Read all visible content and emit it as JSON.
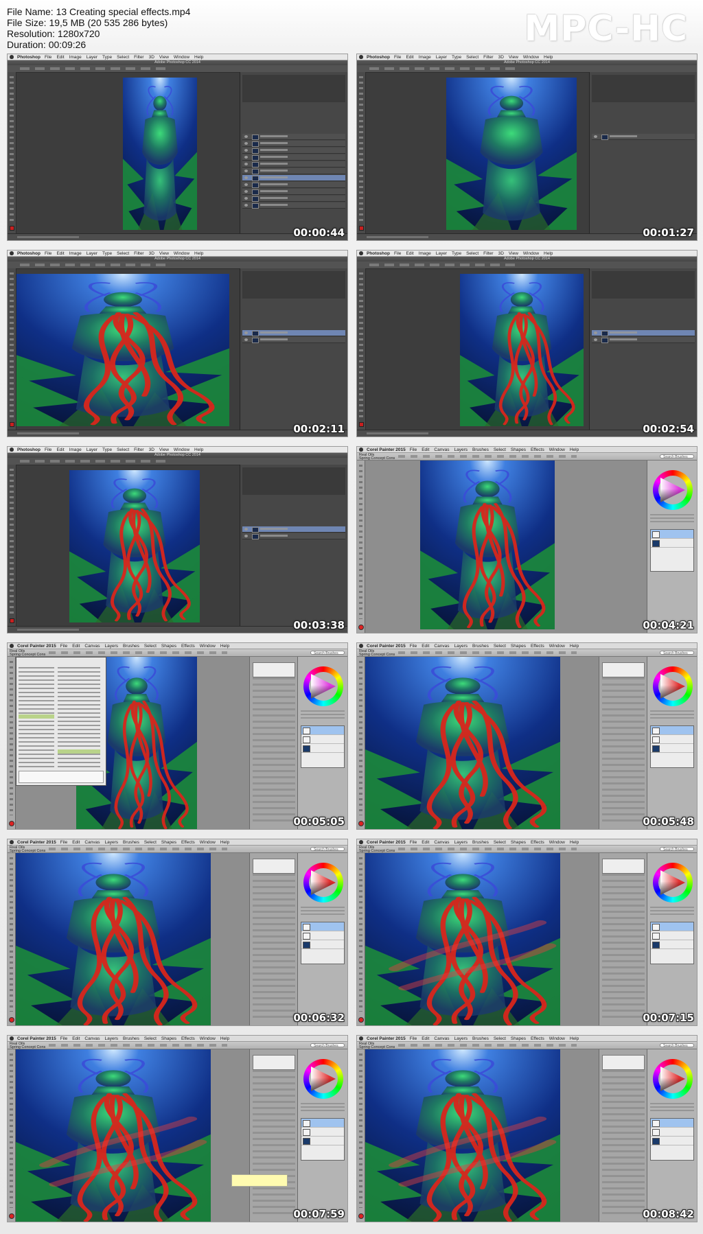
{
  "header": {
    "file_name": "File Name: 13 Creating special effects.mp4",
    "file_size": "File Size: 19,5 MB (20 535 286 bytes)",
    "resolution": "Resolution: 1280x720",
    "duration": "Duration: 00:09:26"
  },
  "brand": "MPC-HC",
  "photoshop": {
    "app": "Photoshop",
    "menu": [
      "File",
      "Edit",
      "Image",
      "Layer",
      "Type",
      "Select",
      "Filter",
      "3D",
      "View",
      "Window",
      "Help"
    ],
    "window_title": "Adobe Photoshop CC 2014"
  },
  "painter": {
    "app": "Corel Painter 2015",
    "menu": [
      "File",
      "Edit",
      "Canvas",
      "Layers",
      "Brushes",
      "Select",
      "Shapes",
      "Effects",
      "Window",
      "Help"
    ],
    "brush_category": "Real Oils",
    "brush_variant": "Spring Concept Cons",
    "search_placeholder": "Search Brushes"
  },
  "frames": [
    {
      "app": "photoshop",
      "timestamp": "00:00:44",
      "view": "narrow"
    },
    {
      "app": "photoshop",
      "timestamp": "00:01:27",
      "view": "medium"
    },
    {
      "app": "photoshop",
      "timestamp": "00:02:11",
      "view": "closeup"
    },
    {
      "app": "photoshop",
      "timestamp": "00:02:54",
      "view": "hair"
    },
    {
      "app": "photoshop",
      "timestamp": "00:03:38",
      "view": "hair-full"
    },
    {
      "app": "painter",
      "timestamp": "00:04:21",
      "view": "painter-wide"
    },
    {
      "app": "painter",
      "timestamp": "00:05:05",
      "view": "painter-brushlib"
    },
    {
      "app": "painter",
      "timestamp": "00:05:48",
      "view": "painter-panels"
    },
    {
      "app": "painter",
      "timestamp": "00:06:32",
      "view": "painter-panels"
    },
    {
      "app": "painter",
      "timestamp": "00:07:15",
      "view": "painter-panels"
    },
    {
      "app": "painter",
      "timestamp": "00:07:59",
      "view": "painter-tooltip"
    },
    {
      "app": "painter",
      "timestamp": "00:08:42",
      "view": "painter-panels"
    }
  ],
  "colors": {
    "water_deep": "#0a1f5c",
    "water_light": "#3f7fe0",
    "figure_green": "#2fbf6a",
    "hair_red": "#d8261c",
    "ui_dark": "#474747",
    "ui_light": "#b4b4b4"
  }
}
